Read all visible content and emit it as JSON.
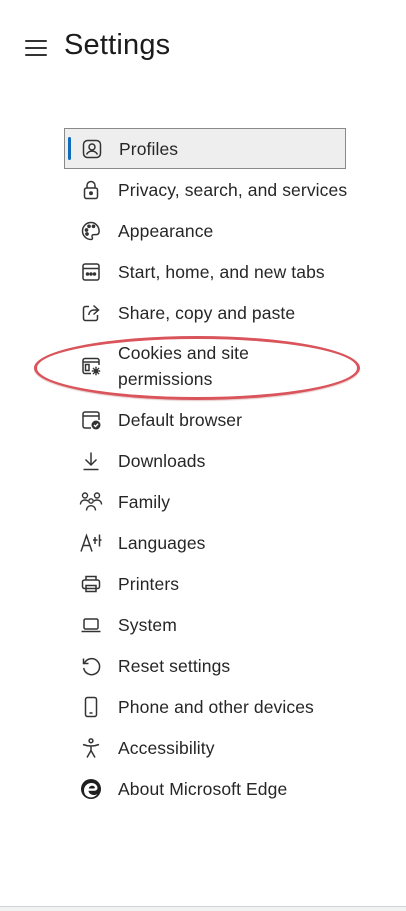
{
  "header": {
    "title": "Settings",
    "menu_icon": "hamburger-icon"
  },
  "nav": {
    "selected_index": 0,
    "accent_color": "#0f6cbd",
    "items": [
      {
        "label": "Profiles",
        "icon": "profile-icon"
      },
      {
        "label": "Privacy, search, and services",
        "icon": "lock-icon"
      },
      {
        "label": "Appearance",
        "icon": "palette-icon"
      },
      {
        "label": "Start, home, and new tabs",
        "icon": "start-page-icon"
      },
      {
        "label": "Share, copy and paste",
        "icon": "share-icon"
      },
      {
        "label": "Cookies and site\npermissions",
        "icon": "cookies-permissions-icon"
      },
      {
        "label": "Default browser",
        "icon": "default-browser-icon"
      },
      {
        "label": "Downloads",
        "icon": "download-icon"
      },
      {
        "label": "Family",
        "icon": "family-icon"
      },
      {
        "label": "Languages",
        "icon": "languages-icon"
      },
      {
        "label": "Printers",
        "icon": "printer-icon"
      },
      {
        "label": "System",
        "icon": "laptop-icon"
      },
      {
        "label": "Reset settings",
        "icon": "reset-icon"
      },
      {
        "label": "Phone and other devices",
        "icon": "phone-icon"
      },
      {
        "label": "Accessibility",
        "icon": "accessibility-icon"
      },
      {
        "label": "About Microsoft Edge",
        "icon": "edge-logo-icon"
      }
    ]
  },
  "annotation": {
    "highlight_color": "#d9545b",
    "highlighted_item": "Cookies and site\npermissions"
  }
}
